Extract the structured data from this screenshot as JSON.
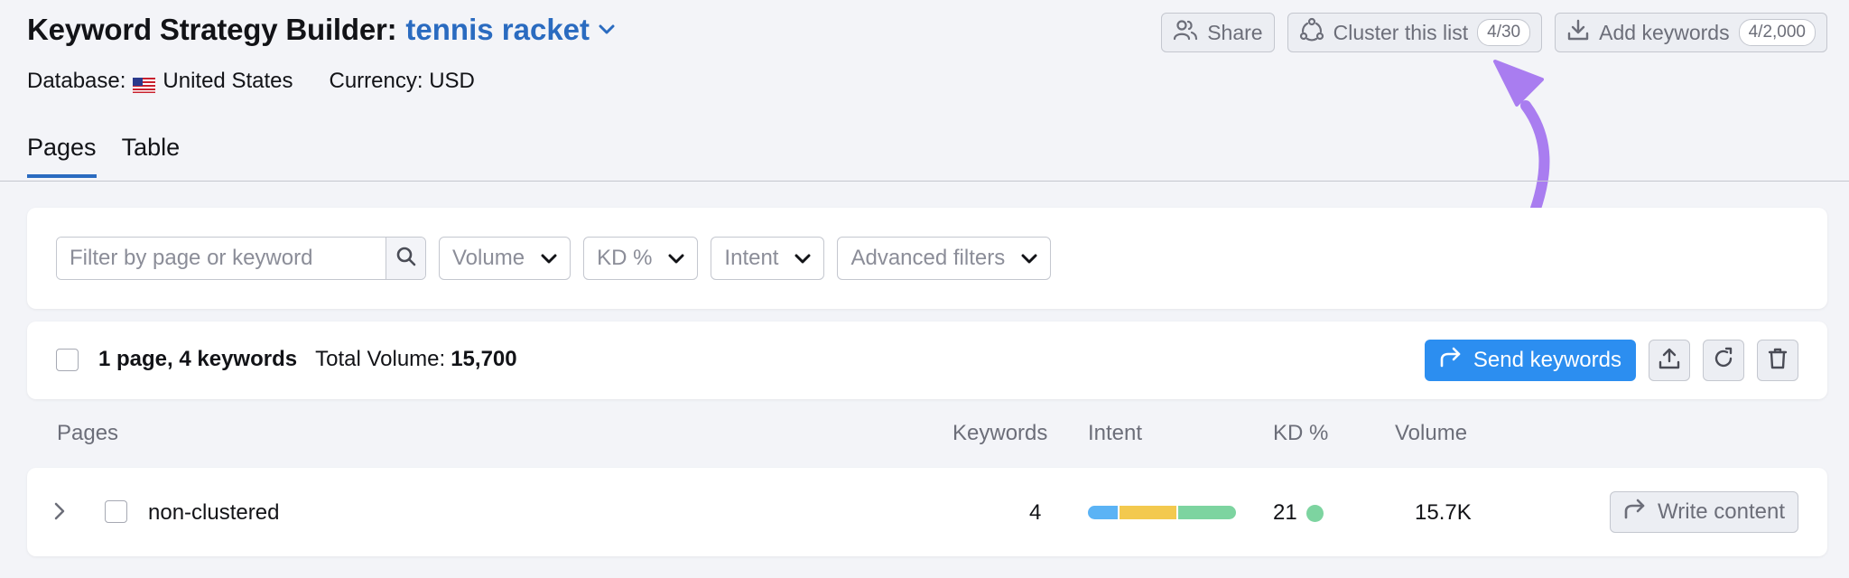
{
  "header": {
    "title": "Keyword Strategy Builder:",
    "project": "tennis racket",
    "database_label": "Database:",
    "database_value": "United States",
    "currency": "Currency: USD",
    "share_label": "Share",
    "cluster_label": "Cluster this list",
    "cluster_badge": "4/30",
    "add_label": "Add keywords",
    "add_badge": "4/2,000"
  },
  "tabs": [
    {
      "label": "Pages",
      "active": true
    },
    {
      "label": "Table",
      "active": false
    }
  ],
  "filters": {
    "search_placeholder": "Filter by page or keyword",
    "volume": "Volume",
    "kd": "KD %",
    "intent": "Intent",
    "advanced": "Advanced filters"
  },
  "summary": {
    "count": "1 page, 4 keywords",
    "volume_label": "Total Volume:",
    "volume_value": "15,700",
    "send_label": "Send keywords"
  },
  "table": {
    "columns": [
      "Pages",
      "Keywords",
      "Intent",
      "KD %",
      "Volume"
    ],
    "rows": [
      {
        "page": "non-clustered",
        "keywords": "4",
        "intent_segments": [
          {
            "color": "#5bb3f5",
            "share": 0.2
          },
          {
            "color": "#f3c94e",
            "share": 0.4
          },
          {
            "color": "#7dd4a0",
            "share": 0.4
          }
        ],
        "kd": "21",
        "kd_color": "#7dd4a0",
        "volume": "15.7K",
        "action": "Write content"
      }
    ]
  },
  "colors": {
    "accent": "#2a6bc0",
    "primary_button": "#2c8ef0",
    "annotation_arrow": "#a97df0"
  }
}
